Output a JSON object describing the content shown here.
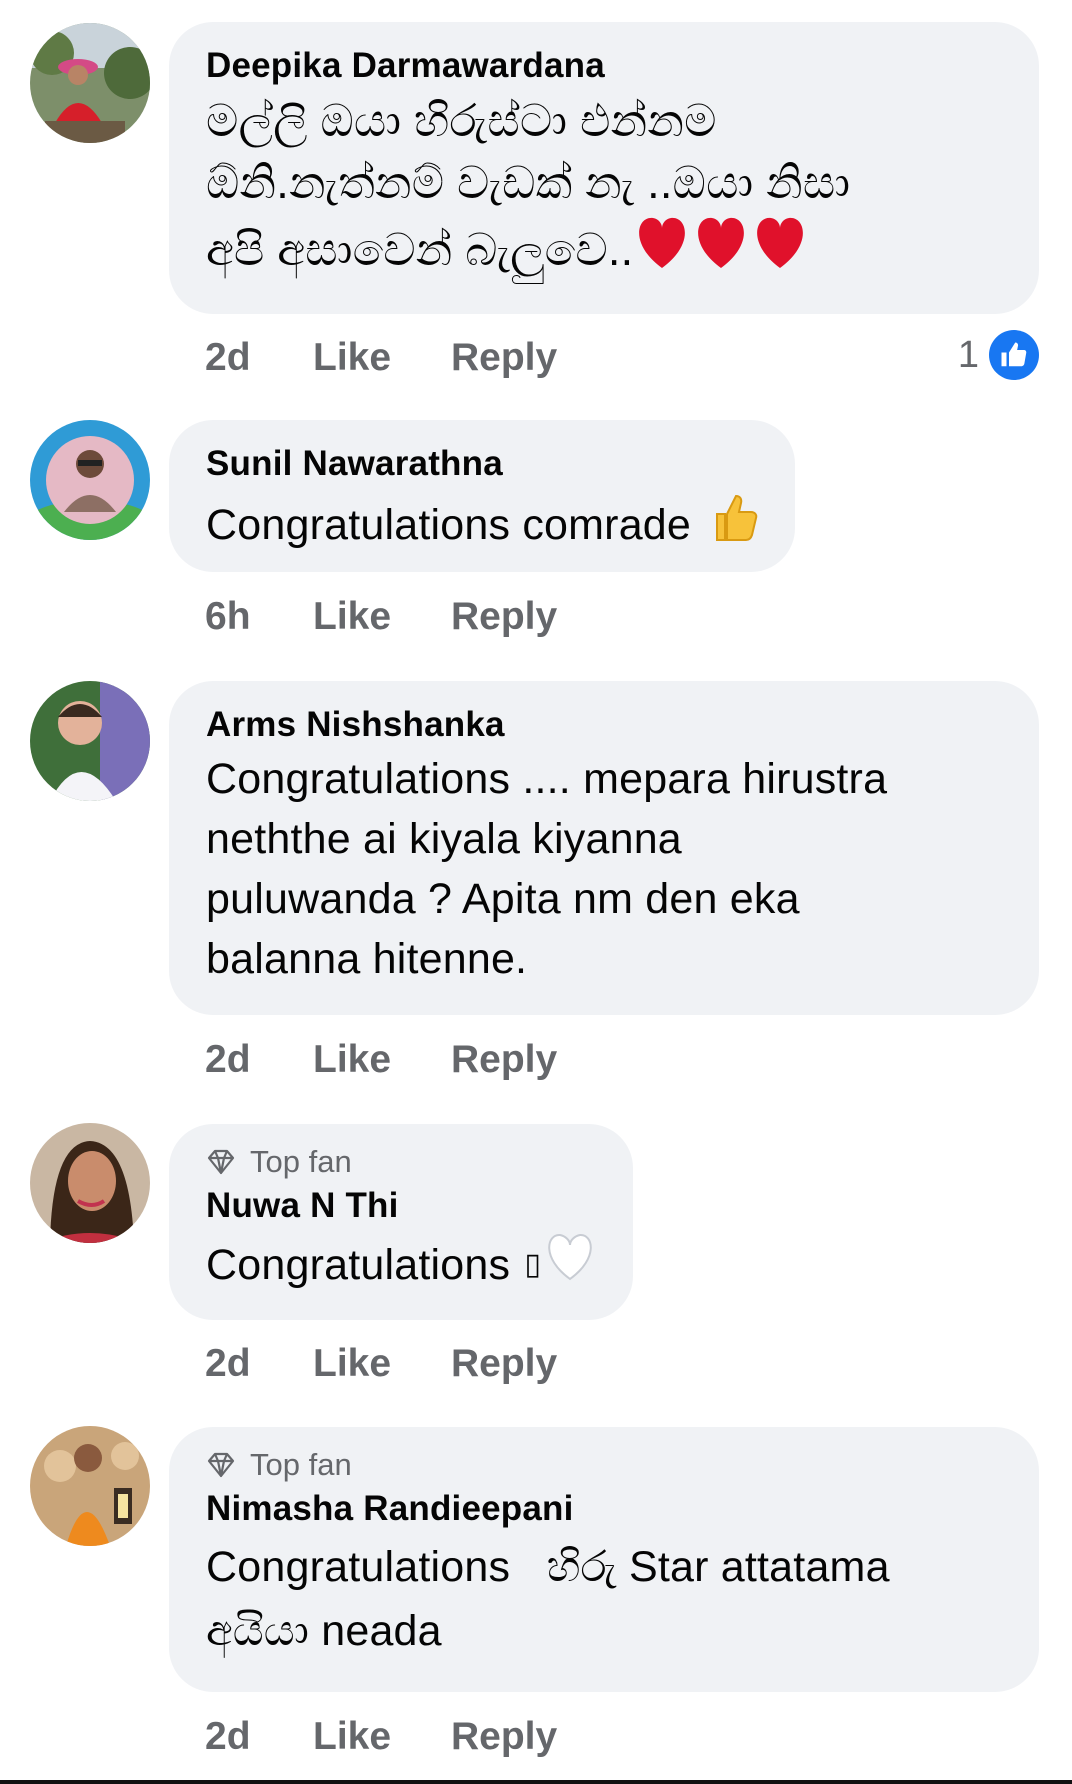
{
  "comments": [
    {
      "author": "Deepika Darmawardana",
      "lines": [
        "මල්ලි ඔයා හිරුස්ටා එන්නම",
        "ඕනි.නැත්නම් වැඩක් නැ ..ඔයා නිසා",
        "අපි අසාවෙන් බැලුවෙ.."
      ],
      "time": "2d",
      "like": "Like",
      "reply": "Reply",
      "reaction_count": "1",
      "emoji": "heart-red-x3"
    },
    {
      "author": "Sunil Nawarathna",
      "lines": [
        "Congratulations comrade"
      ],
      "time": "6h",
      "like": "Like",
      "reply": "Reply",
      "emoji": "thumbs-up"
    },
    {
      "author": "Arms Nishshanka",
      "lines": [
        "Congratulations .... mepara hirustra",
        "neththe ai kiyala kiyanna",
        "puluwanda ? Apita nm den eka",
        "balanna hitenne."
      ],
      "time": "2d",
      "like": "Like",
      "reply": "Reply"
    },
    {
      "badge": "Top fan",
      "author": "Nuwa N Thi",
      "lines": [
        "Congratulations "
      ],
      "missing_glyph": "▯",
      "time": "2d",
      "like": "Like",
      "reply": "Reply",
      "emoji": "heart-white"
    },
    {
      "badge": "Top fan",
      "author": "Nimasha Randieepani",
      "lines": [
        "Congratulations   හිරු Star attatama",
        "අයියා neada"
      ],
      "time": "2d",
      "like": "Like",
      "reply": "Reply"
    }
  ],
  "colors": {
    "bubble": "#f0f2f5",
    "secondary_text": "#65676b",
    "like_blue": "#1877f2",
    "heart_red": "#e0112b"
  }
}
